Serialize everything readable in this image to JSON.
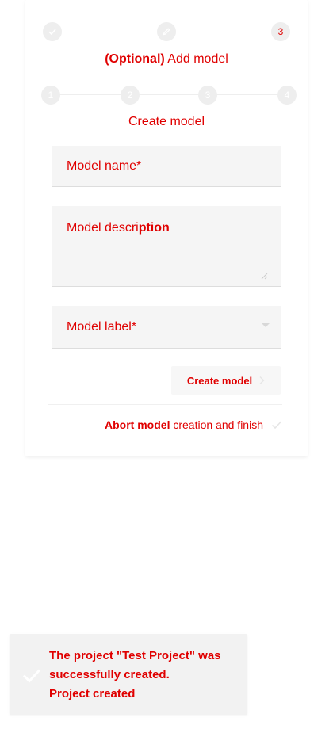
{
  "wizard": {
    "top_steps": [
      {
        "state": "done",
        "icon": "check-icon"
      },
      {
        "state": "editable",
        "icon": "pencil-icon"
      },
      {
        "state": "current",
        "number": "3"
      }
    ],
    "heading_optional": "(Optional)",
    "heading_text": "Add model",
    "sub_steps": [
      {
        "number": "1"
      },
      {
        "number": "2"
      },
      {
        "number": "3"
      },
      {
        "number": "4"
      }
    ],
    "section_title": "Create model"
  },
  "form": {
    "model_name_placeholder": "Model name*",
    "model_description_placeholder_start": "Model descri",
    "model_description_placeholder_end": "ption",
    "model_label_placeholder": "Model label*",
    "create_button_label": "Create model"
  },
  "abort": {
    "bold_part": "Abort model",
    "rest": "creation and finish"
  },
  "toast": {
    "message": "The project \"Test Project\" was successfully created.",
    "detail": "Project created"
  },
  "colors": {
    "text": "#e00000",
    "step_bg": "#eeeeee",
    "field_bg": "#f5f5f5",
    "toast_bg": "#f2f2f2"
  }
}
